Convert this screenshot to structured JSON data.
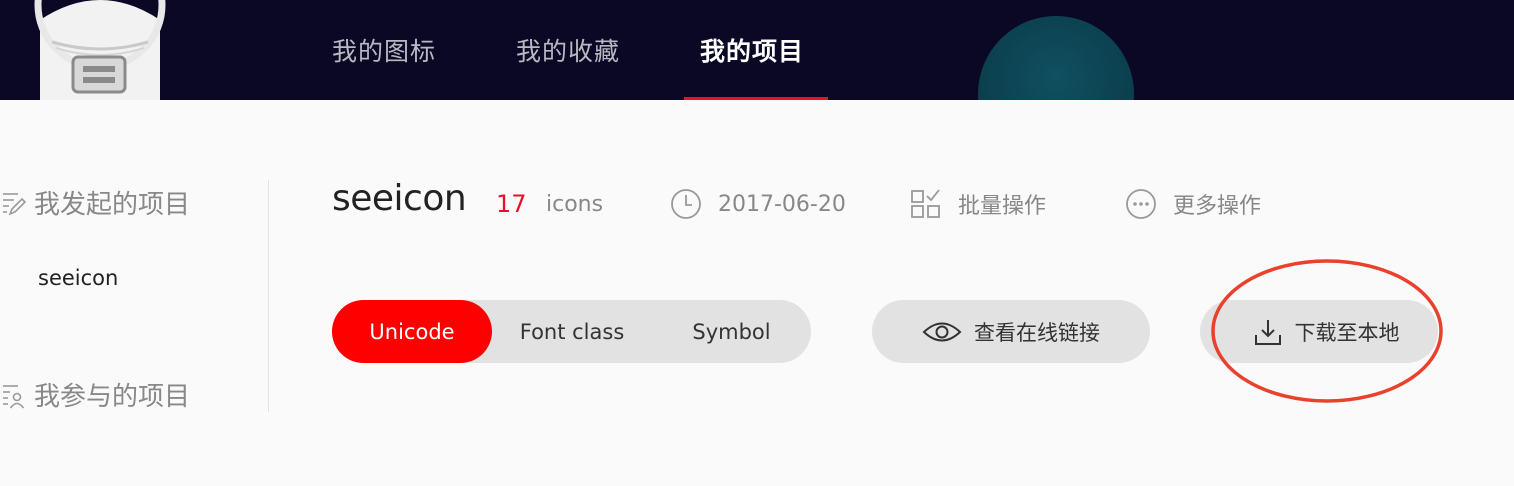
{
  "nav": {
    "tabs": [
      {
        "label": "我的图标",
        "active": false
      },
      {
        "label": "我的收藏",
        "active": false
      },
      {
        "label": "我的项目",
        "active": true
      }
    ],
    "accent": "#e8112d"
  },
  "sidebar": {
    "groups": [
      {
        "label": "我发起的项目",
        "icon": "edit-list-icon",
        "items": [
          "seeicon"
        ]
      },
      {
        "label": "我参与的项目",
        "icon": "user-list-icon",
        "items": []
      }
    ]
  },
  "project": {
    "name": "seeicon",
    "count": "17",
    "count_unit": "icons",
    "date": "2017-06-20",
    "batch_label": "批量操作",
    "more_label": "更多操作"
  },
  "tabs": {
    "options": [
      "Unicode",
      "Font class",
      "Symbol"
    ],
    "selected": "Unicode"
  },
  "actions": {
    "view_link": "查看在线链接",
    "download": "下载至本地"
  },
  "colors": {
    "header_bg": "#0a0825",
    "active_tab": "#ff0000",
    "count": "#e8112d",
    "annotation": "#e8412c"
  }
}
